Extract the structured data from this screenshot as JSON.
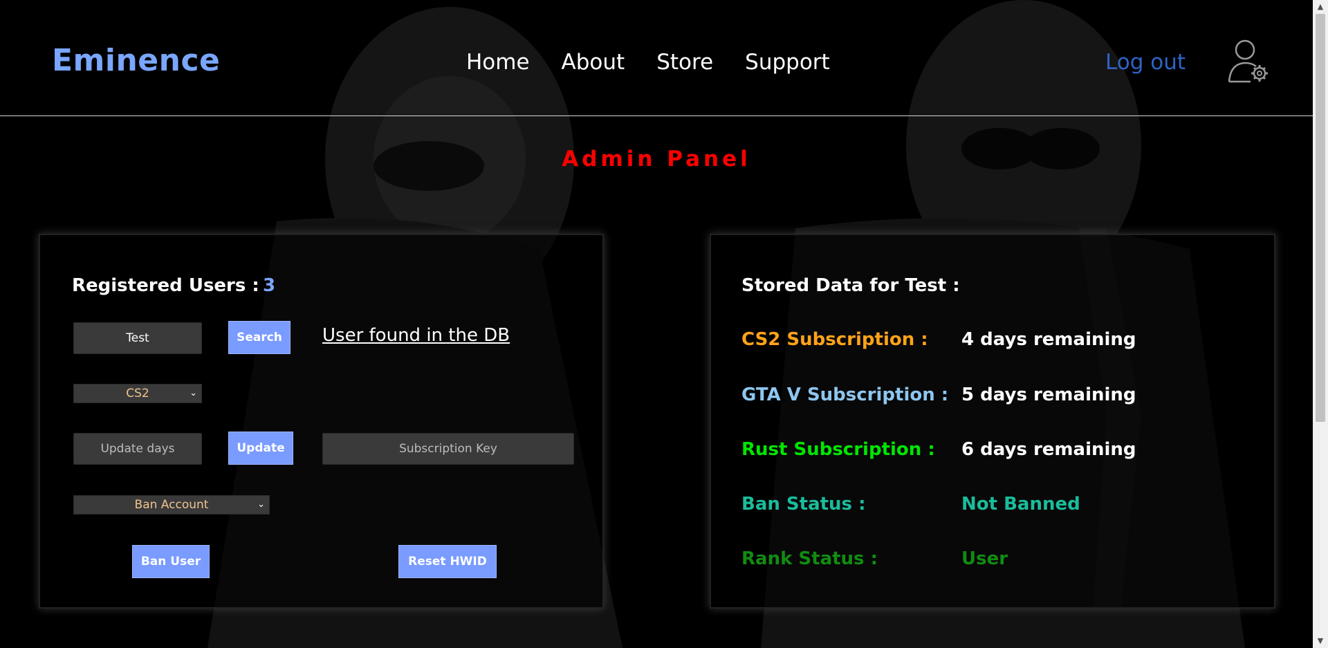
{
  "header": {
    "brand": "Eminence",
    "nav": [
      "Home",
      "About",
      "Store",
      "Support"
    ],
    "logout": "Log out"
  },
  "title": "Admin Panel",
  "left_panel": {
    "registered_label": "Registered Users :",
    "registered_count": "3",
    "search_value": "Test",
    "search_button": "Search",
    "status_message": "User found in the DB",
    "game_select": "CS2",
    "update_days_placeholder": "Update days",
    "update_button": "Update",
    "subscription_key_placeholder": "Subscription Key",
    "action_select": "Ban Account",
    "ban_button": "Ban User",
    "reset_button": "Reset HWID"
  },
  "right_panel": {
    "title": "Stored Data for Test :",
    "rows": [
      {
        "label": "CS2 Subscription :",
        "value": "4 days remaining",
        "label_color": "#ffa31a",
        "value_color": "#ffffff"
      },
      {
        "label": "GTA V Subscription :",
        "value": "5 days remaining",
        "label_color": "#8ec6ef",
        "value_color": "#ffffff"
      },
      {
        "label": "Rust Subscription :",
        "value": "6 days remaining",
        "label_color": "#00e600",
        "value_color": "#ffffff"
      },
      {
        "label": "Ban Status :",
        "value": "Not Banned",
        "label_color": "#1abc9c",
        "value_color": "#1abc9c"
      },
      {
        "label": "Rank Status :",
        "value": "User",
        "label_color": "#118c11",
        "value_color": "#118c11"
      }
    ]
  },
  "colors": {
    "brand": "#7aa6ff",
    "title": "#ff0000",
    "button": "#7a9bff",
    "logout": "#2f63c6"
  },
  "icons": [
    "user-settings-icon",
    "chevron-down-icon"
  ]
}
